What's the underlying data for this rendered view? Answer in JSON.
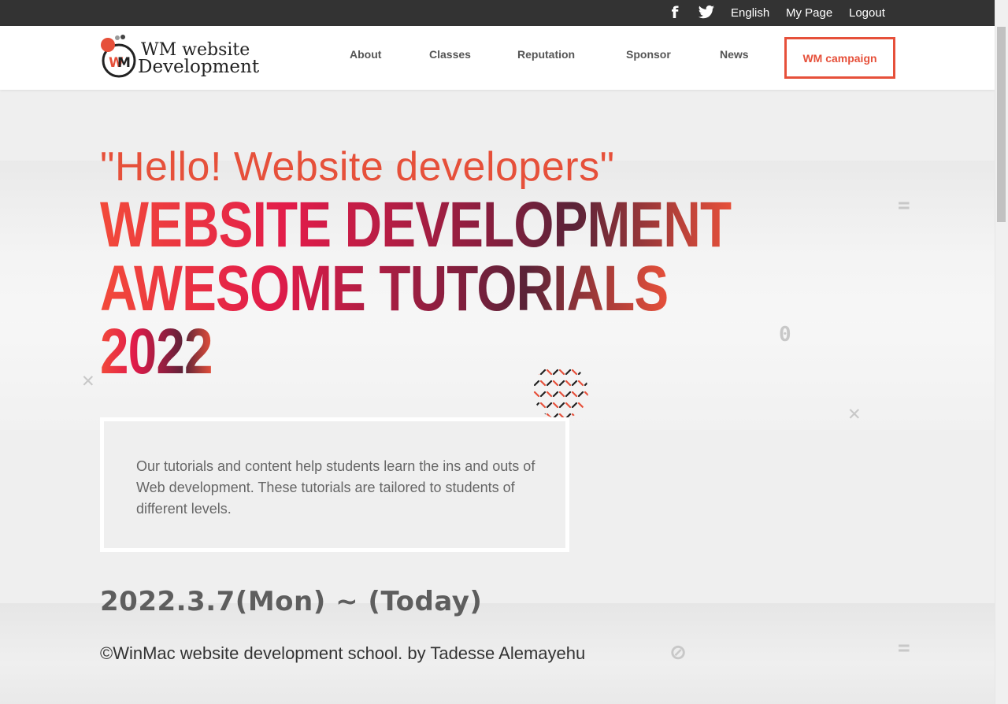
{
  "topbar": {
    "facebook_icon": "facebook-icon",
    "twitter_icon": "twitter-icon",
    "links": [
      "English",
      "My Page",
      "Logout"
    ]
  },
  "header": {
    "logo_line1": "WM website",
    "logo_line2": "Development",
    "nav": [
      "About",
      "Classes",
      "Reputation",
      "Sponsor",
      "News"
    ],
    "campaign": "WM campaign"
  },
  "hero": {
    "greeting": "\"Hello! Website developers\"",
    "headline": [
      "WEBSITE DEVELOPMENT",
      "AWESOME TUTORIALS",
      "2022"
    ],
    "description": "Our tutorials and content help students learn the ins and outs of Web development. These tutorials are tailored to students of different levels.",
    "date": "2022.3.7(Mon) ~ (Today)",
    "copyright": "©WinMac website development school. by Tadesse Alemayehu"
  },
  "colors": {
    "accent": "#e6503a",
    "topbar": "#333333",
    "crimson": "#e21c4a",
    "maroon": "#5a2338"
  }
}
